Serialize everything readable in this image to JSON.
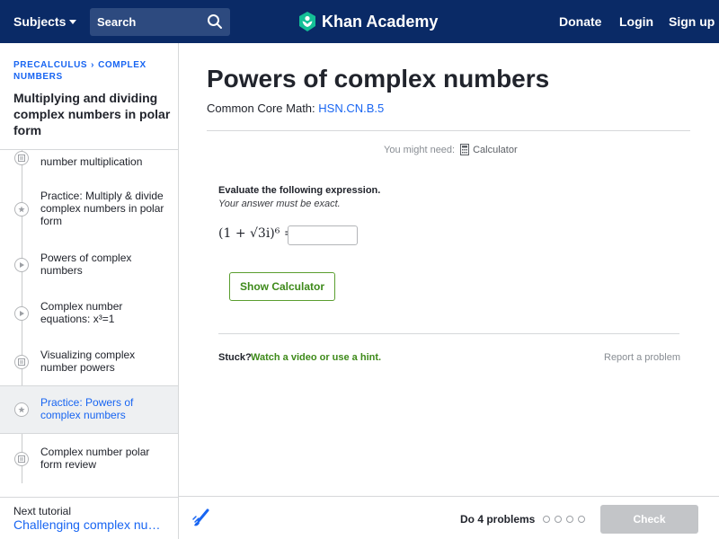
{
  "topbar": {
    "subjects": "Subjects",
    "search_label": "Search",
    "logo_text": "Khan Academy",
    "donate": "Donate",
    "login": "Login",
    "signup": "Sign up"
  },
  "sidebar": {
    "breadcrumb_1": "PRECALCULUS",
    "breadcrumb_2": "COMPLEX NUMBERS",
    "title": "Multiplying and dividing complex numbers in polar form",
    "items": [
      {
        "label": "number multiplication",
        "icon": "article-icon"
      },
      {
        "label": "Practice: Multiply & divide complex numbers in polar form",
        "icon": "star-icon"
      },
      {
        "label": "Powers of complex numbers",
        "icon": "play-icon"
      },
      {
        "label": "Complex number equations: x³=1",
        "icon": "play-icon"
      },
      {
        "label": "Visualizing complex number powers",
        "icon": "article-icon"
      },
      {
        "label": "Practice: Powers of complex numbers",
        "icon": "star-icon"
      },
      {
        "label": "Complex number polar form review",
        "icon": "article-icon"
      }
    ],
    "next_label": "Next tutorial",
    "next_link": "Challenging complex numb…"
  },
  "main": {
    "title": "Powers of complex numbers",
    "cc_prefix": "Common Core Math:",
    "cc_code": "HSN.CN.B.5",
    "you_might_need": "You might need:",
    "calculator": "Calculator",
    "question": "Evaluate the following expression.",
    "instruction": "Your answer must be exact.",
    "expression": "(1 + √3i)⁶ =",
    "show_calculator": "Show Calculator",
    "stuck": "Stuck?",
    "hint": "Watch a video or use a hint.",
    "report": "Report a problem"
  },
  "bottombar": {
    "do_problems": "Do 4 problems",
    "check": "Check"
  },
  "colors": {
    "topbar": "#0a2a66",
    "link": "#1865f2",
    "green": "#3e8a1a",
    "check_disabled": "#c3c5c8"
  }
}
